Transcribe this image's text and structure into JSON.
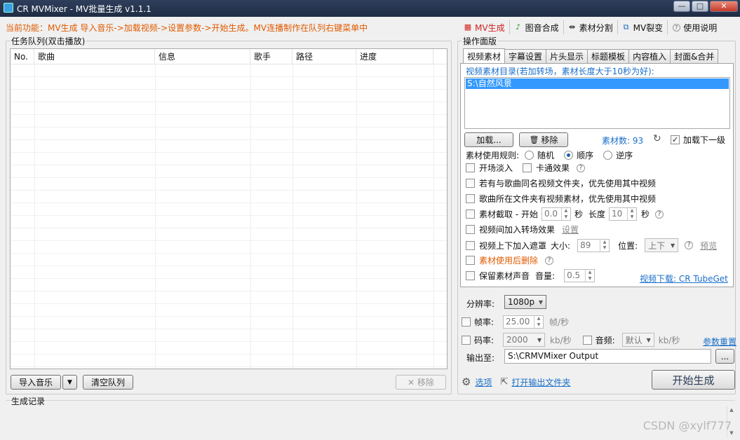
{
  "window": {
    "title": "CR MVMixer - MV批量生成 v1.1.1",
    "controls": [
      "—",
      "□",
      "✕"
    ]
  },
  "header": {
    "current_function": "当前功能：MV生成  导入音乐->加载视频->设置参数->开始生成。MV连播制作在队列右键菜单中",
    "nav": [
      {
        "label": "MV生成",
        "icon": "film-icon"
      },
      {
        "label": "图音合成",
        "icon": "image-music-icon"
      },
      {
        "label": "素材分割",
        "icon": "split-icon"
      },
      {
        "label": "MV裂变",
        "icon": "fission-icon"
      },
      {
        "label": "使用说明",
        "icon": "help-icon"
      }
    ]
  },
  "queue": {
    "title": "任务队列(双击播放)",
    "columns": [
      "No.",
      "歌曲",
      "信息",
      "歌手",
      "路径",
      "进度"
    ],
    "rows": [],
    "import_button": "导入音乐",
    "dropdown_arrow": "▼",
    "clear_button": "清空队列",
    "remove_button": "✕ 移除"
  },
  "panel": {
    "title": "操作面版",
    "tabs": [
      "视频素材",
      "字幕设置",
      "片头显示",
      "标题模板",
      "内容植入",
      "封面&合并"
    ],
    "active_tab": 0,
    "video_dir_label": "视频素材目录(若加转场，素材长度大于10秒为好):",
    "video_dirs": [
      "S:\\自然风景"
    ],
    "load_button": "加载...",
    "remove_button": "移除",
    "material_count_label": "素材数: 93",
    "refresh_icon": "↻",
    "load_next_level": "加载下一级",
    "usage_rule_label": "素材使用规则:",
    "usage_rules": [
      "随机",
      "顺序",
      "逆序"
    ],
    "usage_rule_selected": 1,
    "fade_in": "开场淡入",
    "cartoon_effect": "卡通效果",
    "same_name_folder": "若有与歌曲同名视频文件夹，优先使用其中视频",
    "song_folder_video": "歌曲所在文件夹有视频素材，优先使用其中视频",
    "clip_start_label": "素材截取 - 开始",
    "clip_start_value": "0.0",
    "sec1": "秒",
    "length_label": "长度",
    "clip_length_value": "10",
    "sec2": "秒",
    "transition_label": "视频间加入转场效果",
    "transition_settings": "设置",
    "mask_label": "视频上下加入遮罩",
    "mask_size_label": "大小:",
    "mask_size_value": "89",
    "mask_pos_label": "位置:",
    "mask_pos_value": "上下",
    "preview_link": "预览",
    "delete_after_use": "素材使用后删除",
    "keep_audio": "保留素材声音",
    "volume_label": "音量:",
    "volume_value": "0.5",
    "download_link": "视频下载: CR TubeGet"
  },
  "output": {
    "resolution_label": "分辨率:",
    "resolution_value": "1080p",
    "fps_label": "帧率:",
    "fps_value": "25.00",
    "fps_unit": "帧/秒",
    "bitrate_label": "码率:",
    "bitrate_value": "2000",
    "bitrate_unit": "kb/秒",
    "audio_label": "音频:",
    "audio_value": "默认",
    "audio_unit": "kb/秒",
    "reset_link": "参数重置",
    "output_label": "输出至:",
    "output_path": "S:\\CRMVMixer Output",
    "browse_button": "...",
    "options_link": "选项",
    "open_folder_link": "打开输出文件夹",
    "start_button": "开始生成"
  },
  "log": {
    "title": "生成记录"
  },
  "watermark": "CSDN @xylf777"
}
